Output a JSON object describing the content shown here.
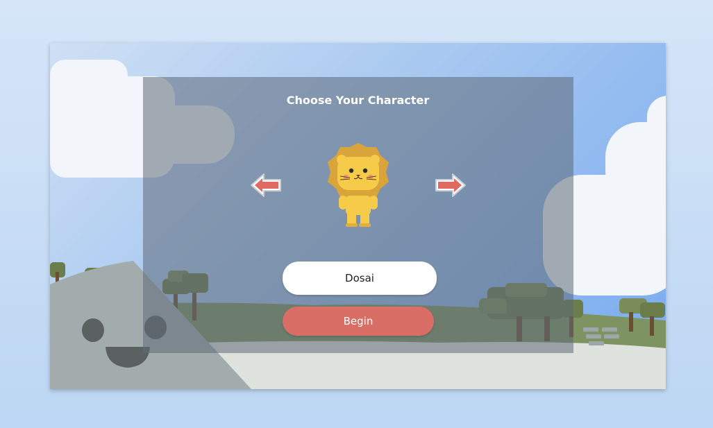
{
  "screen": {
    "title": "Choose Your Character"
  },
  "character_select": {
    "character_icon": "lion-character-icon",
    "prev_icon": "left-arrow-icon",
    "next_icon": "right-arrow-icon"
  },
  "name_input": {
    "value": "Dosai"
  },
  "begin_button": {
    "label": "Begin"
  },
  "colors": {
    "panel": "#5f6978",
    "button_accent": "#d86e66",
    "arrow": "#e06a62",
    "lion_body": "#f6cb4a",
    "lion_mane": "#d9a53a"
  }
}
